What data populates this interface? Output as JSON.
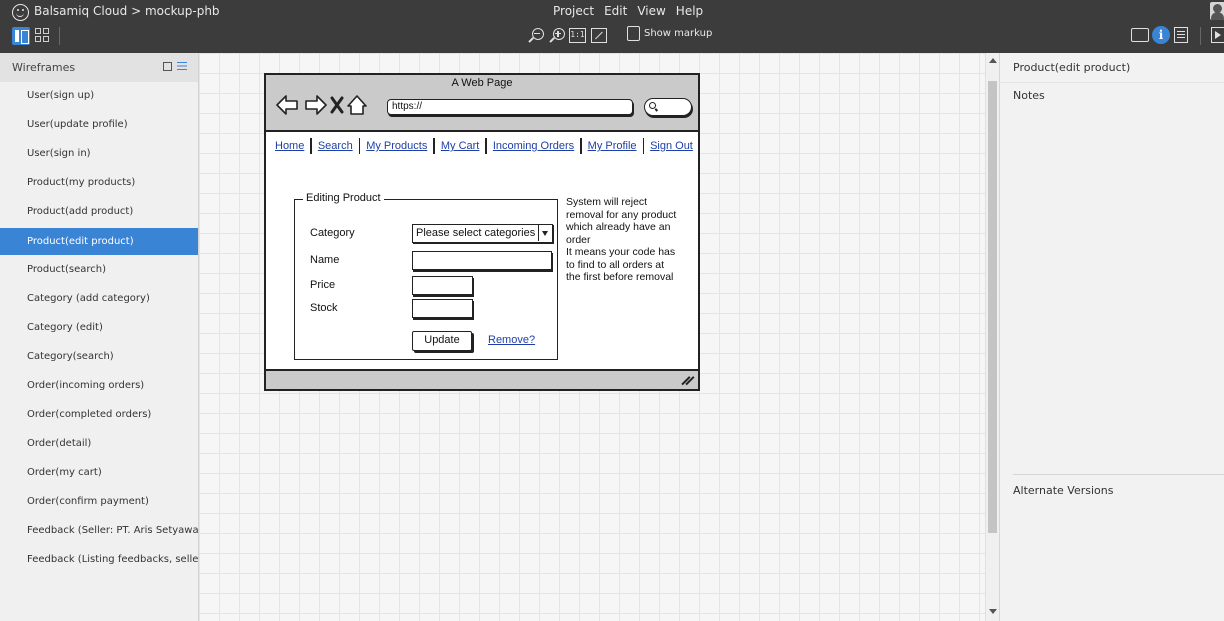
{
  "app": {
    "title": "Balsamiq Cloud > mockup-phb",
    "menu": [
      "Project",
      "Edit",
      "View",
      "Help"
    ]
  },
  "toolbar": {
    "zoom_actual_label": "1:1",
    "show_markup_label": "Show markup",
    "info_label": "i"
  },
  "sidebar": {
    "title": "Wireframes",
    "items": [
      {
        "label": "User(sign up)",
        "active": false
      },
      {
        "label": "User(update profile)",
        "active": false
      },
      {
        "label": "User(sign in)",
        "active": false
      },
      {
        "label": "Product(my products)",
        "active": false
      },
      {
        "label": "Product(add product)",
        "active": false
      },
      {
        "label": "Product(edit product)",
        "active": true
      },
      {
        "label": "Product(search)",
        "active": false
      },
      {
        "label": "Category (add category)",
        "active": false
      },
      {
        "label": "Category (edit)",
        "active": false
      },
      {
        "label": "Category(search)",
        "active": false
      },
      {
        "label": "Order(incoming orders)",
        "active": false
      },
      {
        "label": "Order(completed orders)",
        "active": false
      },
      {
        "label": "Order(detail)",
        "active": false
      },
      {
        "label": "Order(my cart)",
        "active": false
      },
      {
        "label": "Order(confirm payment)",
        "active": false
      },
      {
        "label": "Feedback (Seller: PT. Aris Setyawa...",
        "active": false
      },
      {
        "label": "Feedback (Listing feedbacks, selle...",
        "active": false
      }
    ]
  },
  "mockup": {
    "window_title": "A Web Page",
    "url": "https://",
    "nav_links": [
      "Home",
      "Search",
      "My Products",
      "My Cart",
      "Incoming Orders",
      "My Profile",
      "Sign Out"
    ],
    "form": {
      "legend": "Editing Product",
      "category_label": "Category",
      "category_value": "Please select categories",
      "name_label": "Name",
      "price_label": "Price",
      "stock_label": "Stock",
      "update_label": "Update",
      "remove_label": "Remove?"
    },
    "note_lines": [
      "System will reject",
      "removal for any product",
      "which already have an",
      "order",
      "It means your code has",
      "to find to all orders at",
      "the first before removal"
    ]
  },
  "right_panel": {
    "title": "Product(edit product)",
    "notes_label": "Notes",
    "alternate_label": "Alternate Versions"
  },
  "colors": {
    "accent": "#3a84d6",
    "topbar": "#3c3c3c",
    "link": "#1f3fa8"
  }
}
